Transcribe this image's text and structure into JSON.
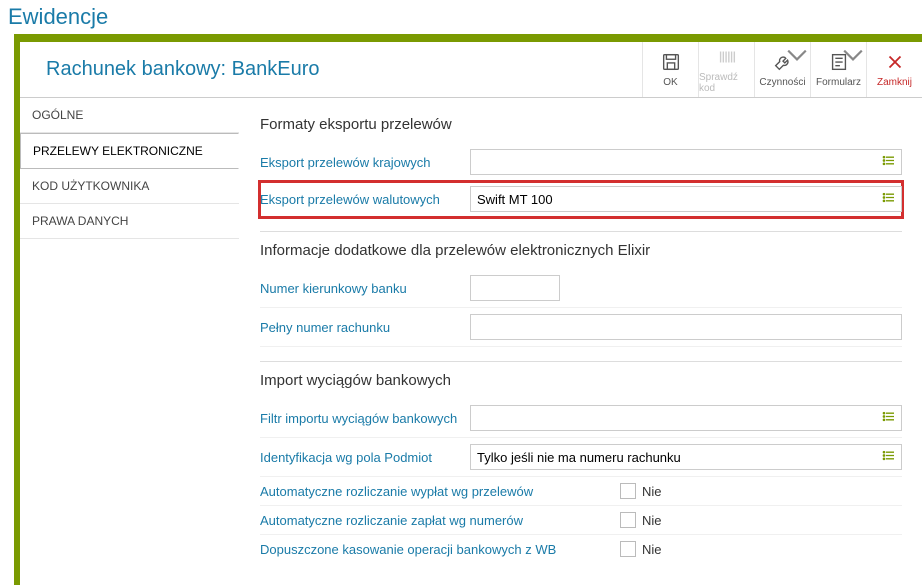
{
  "page_title": "Ewidencje",
  "form_title": "Rachunek bankowy: BankEuro",
  "toolbar": {
    "ok": "OK",
    "check": "Sprawdź kod",
    "actions": "Czynności",
    "form": "Formularz",
    "close": "Zamknij"
  },
  "sidebar": {
    "items": [
      {
        "label": "OGÓLNE"
      },
      {
        "label": "PRZELEWY ELEKTRONICZNE"
      },
      {
        "label": "KOD UŻYTKOWNIKA"
      },
      {
        "label": "PRAWA DANYCH"
      }
    ]
  },
  "sections": {
    "export": {
      "title": "Formaty eksportu przelewów",
      "domestic_label": "Eksport przelewów krajowych",
      "domestic_value": "",
      "foreign_label": "Eksport przelewów walutowych",
      "foreign_value": "Swift MT 100"
    },
    "elixir": {
      "title": "Informacje dodatkowe dla przelewów elektronicznych Elixir",
      "bank_code_label": "Numer kierunkowy banku",
      "bank_code_value": "",
      "account_label": "Pełny numer rachunku",
      "account_value": ""
    },
    "import": {
      "title": "Import wyciągów bankowych",
      "filter_label": "Filtr importu wyciągów bankowych",
      "filter_value": "",
      "ident_label": "Identyfikacja wg pola Podmiot",
      "ident_value": "Tylko jeśli nie ma numeru rachunku",
      "auto_pay_label": "Automatyczne rozliczanie wypłat wg przelewów",
      "auto_pay_value": "Nie",
      "auto_deposit_label": "Automatyczne rozliczanie zapłat wg numerów",
      "auto_deposit_value": "Nie",
      "delete_label": "Dopuszczone kasowanie operacji bankowych z WB",
      "delete_value": "Nie"
    }
  }
}
